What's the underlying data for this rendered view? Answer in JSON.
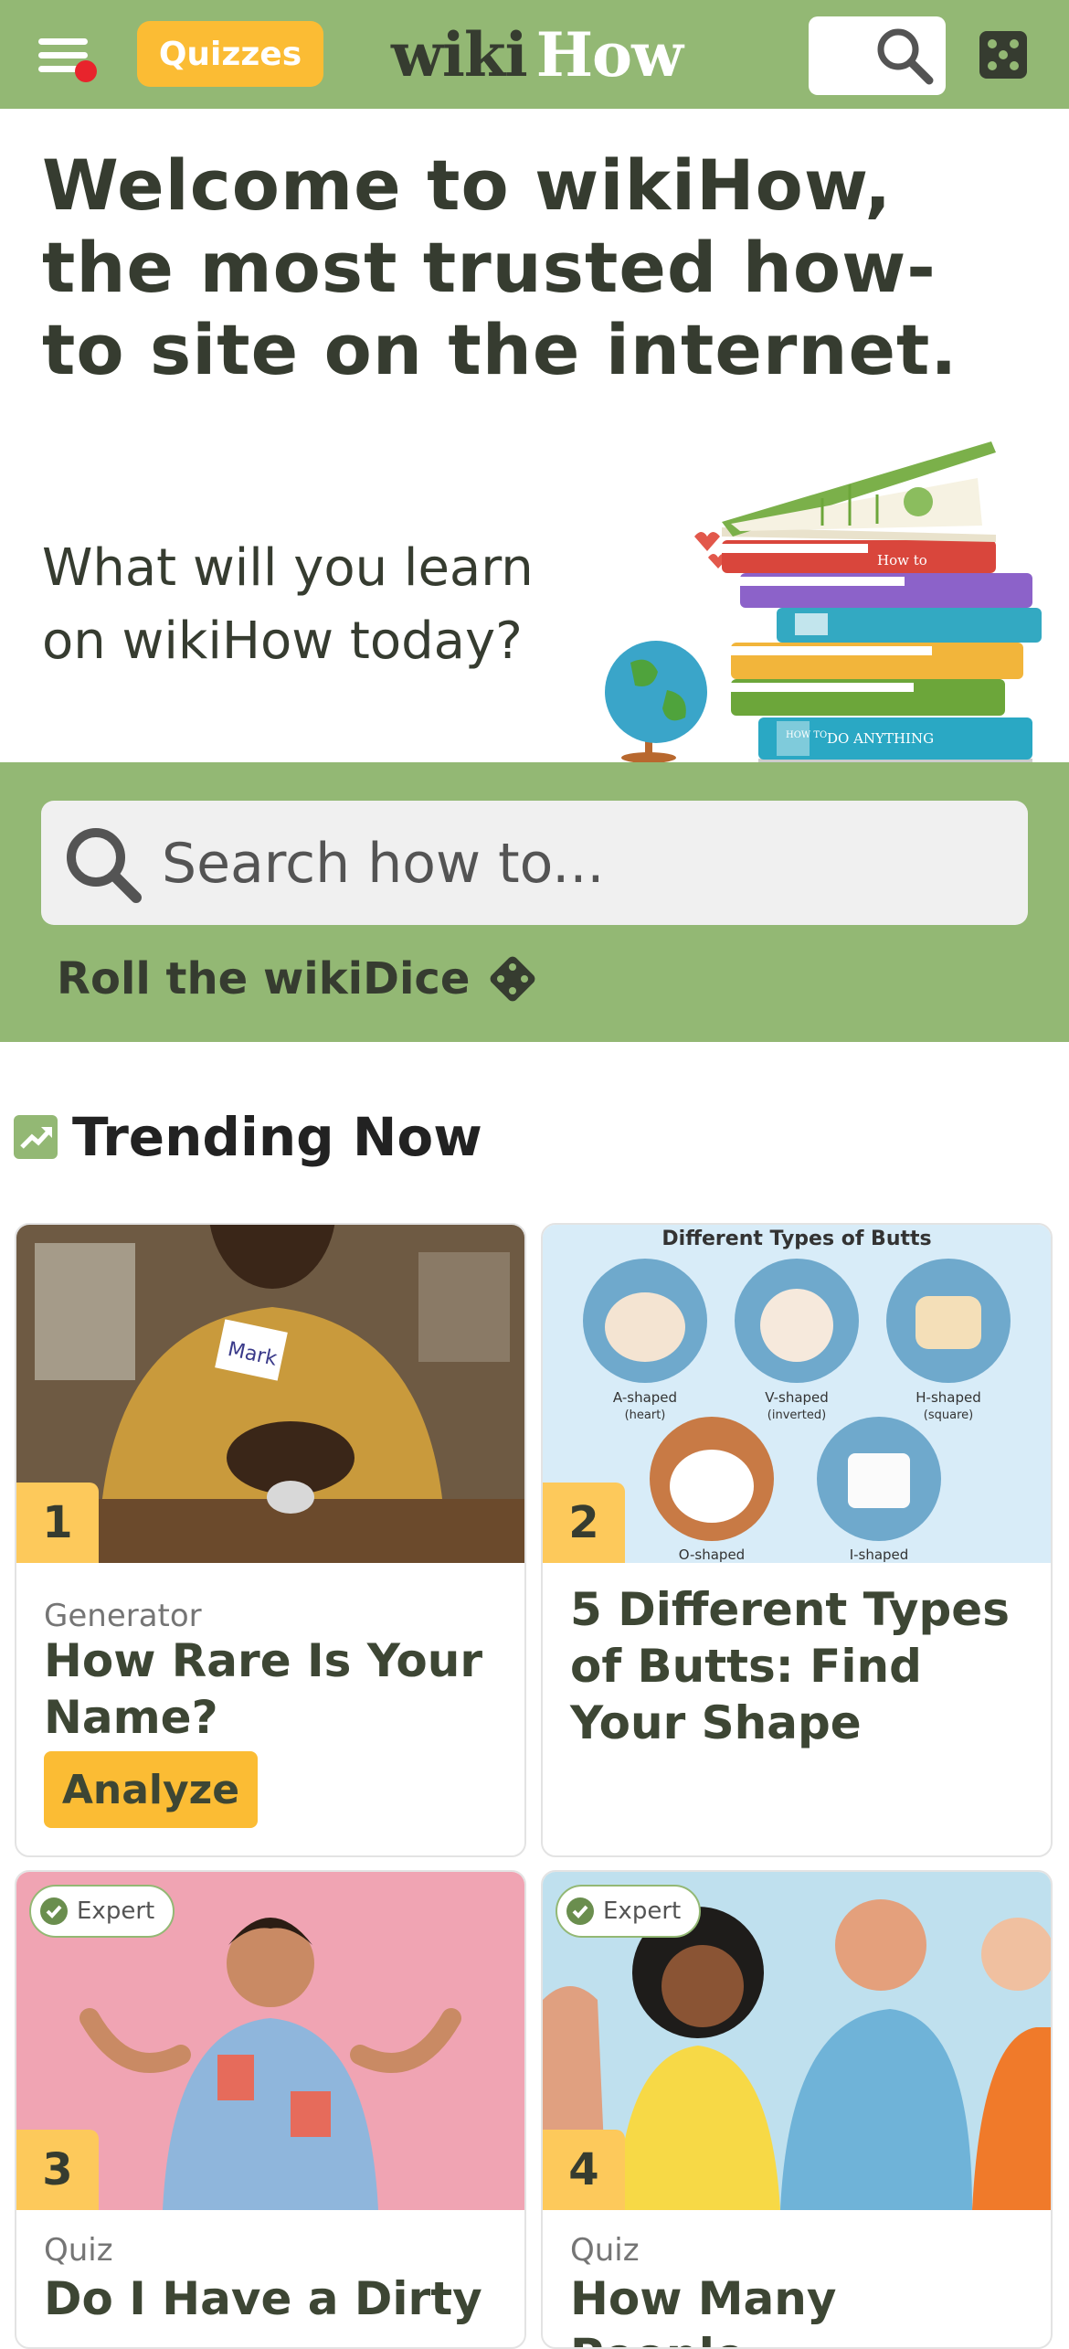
{
  "header": {
    "quizzes_label": "Quizzes",
    "logo_part1": "wiki",
    "logo_part2": "How",
    "icons": [
      "menu-icon",
      "search-icon",
      "dice-icon"
    ]
  },
  "hero": {
    "title": "Welcome to wikiHow, the most trusted how-to site on the internet.",
    "subtitle": "What will you learn on wikiHow today?",
    "art_labels": {
      "book_spine_1": "How to",
      "book_spine_2": "HOW TO",
      "book_spine_3": "DO ANYTHING"
    }
  },
  "search": {
    "placeholder": "Search how to...",
    "dice_label": "Roll the wikiDice"
  },
  "trending": {
    "title": "Trending Now",
    "cards": [
      {
        "rank": "1",
        "kind": "Generator",
        "title": "How Rare Is Your Name?",
        "button": "Analyze",
        "image_label": "Mark"
      },
      {
        "rank": "2",
        "title": "5 Different Types of Butts: Find Your Shape",
        "image_title": "Different Types of Butts",
        "shapes": [
          {
            "name": "A-shaped",
            "sub": "(heart)"
          },
          {
            "name": "V-shaped",
            "sub": "(inverted)"
          },
          {
            "name": "H-shaped",
            "sub": "(square)"
          },
          {
            "name": "O-shaped",
            "sub": ""
          },
          {
            "name": "I-shaped",
            "sub": ""
          }
        ]
      },
      {
        "rank": "3",
        "kind": "Quiz",
        "title": "Do I Have a Dirty",
        "badge": "Expert"
      },
      {
        "rank": "4",
        "kind": "Quiz",
        "title": "How Many People",
        "badge": "Expert"
      }
    ]
  },
  "colors": {
    "brand_green": "#93b874",
    "accent_yellow": "#fbbc34",
    "rank_yellow": "#fdc95b",
    "text_dark": "#363c30",
    "notification_red": "#e8242c"
  }
}
